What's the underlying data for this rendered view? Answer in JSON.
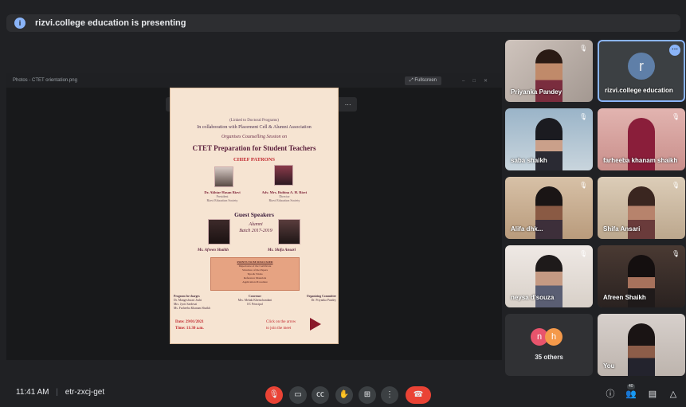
{
  "banner": {
    "icon": "info-icon",
    "icon_text": "i",
    "text": "rizvi.college education is presenting"
  },
  "presentation": {
    "window_title": "Photos - CTET orientation.png",
    "fullscreen_label": "Fullscreen",
    "toolbar_icons": [
      "image-icon",
      "edit-icon",
      "zoom-in-icon",
      "zoom-out-icon",
      "rotate-icon",
      "crop-icon",
      "draw-icon",
      "delete-icon",
      "heart-icon",
      "info-icon",
      "more-icon"
    ],
    "poster": {
      "top_text": "(Linked to Doctoral Programs)",
      "collab": "In collaboration with Placement Cell & Alumni Association",
      "organises": "Organises  Counselling Session  on",
      "title": "CTET Preparation for Student Teachers",
      "chief_patrons_heading": "CHIEF PATRONS",
      "patron1": {
        "name": "Dr. Akhtar Hasan Rizvi",
        "role": "President",
        "org": "Rizvi Education Society"
      },
      "patron2": {
        "name": "Adv. Mrs. Rubina A. H. Rizvi",
        "role": "Director",
        "org": "Rizvi Education Society"
      },
      "guest_heading": "Guest Speakers",
      "alumni_line1": "Alumni",
      "alumni_line2": "Batch  2017-2019",
      "guest1": "Ms. Afreen Shaikh",
      "guest2": "Ms. Shifa Ansari",
      "points_heading": "POINTS TO BE DISCUSSED",
      "points": [
        "Importance of the Certificate",
        "Structure of the Papers",
        "Tips & Tricks",
        "Reference Materials",
        "Application Procedure"
      ],
      "foot_cols": [
        {
          "h": "Program In-charges",
          "lines": [
            "Dr. Mangeshwari Joshi",
            "Mrs. Jyoti Sardesai",
            "Ms. Farheeba Khanam Shaikh"
          ]
        },
        {
          "h": "Convenor",
          "lines": [
            "Mrs. Mehak Khemchandani",
            "I/C Principal"
          ]
        },
        {
          "h": "Organizing Committee",
          "lines": [
            "Dr. Priyanka Pandey"
          ]
        }
      ],
      "date": "Date: 29/01/2021",
      "time": "Time: 11:30 a.m.",
      "click_line1": "Click on the arrow",
      "click_line2": "to join the meet"
    }
  },
  "participants": [
    {
      "name": "Priyanka Pandey"
    },
    {
      "name": "rizvi.college education",
      "initial": "r"
    },
    {
      "name": "saba shaikh"
    },
    {
      "name": "farheeba khanam shaikh"
    },
    {
      "name": "Alifa dhk..."
    },
    {
      "name": "Shifa Ansari"
    },
    {
      "name": "neysa d'souza"
    },
    {
      "name": "Afreen Shaikh"
    },
    {
      "name": "35 others",
      "avatars": [
        "n",
        "h"
      ]
    },
    {
      "name": "You"
    }
  ],
  "bottom": {
    "time": "11:41 AM",
    "separator": "|",
    "meeting_code": "etr-zxcj-get",
    "controls": [
      "mic-off-icon",
      "camera-icon",
      "captions-icon",
      "raise-hand-icon",
      "present-icon",
      "more-icon",
      "end-call-icon"
    ],
    "right_controls": [
      "info-icon",
      "people-icon",
      "chat-icon",
      "activities-icon"
    ],
    "people_badge": "40"
  }
}
